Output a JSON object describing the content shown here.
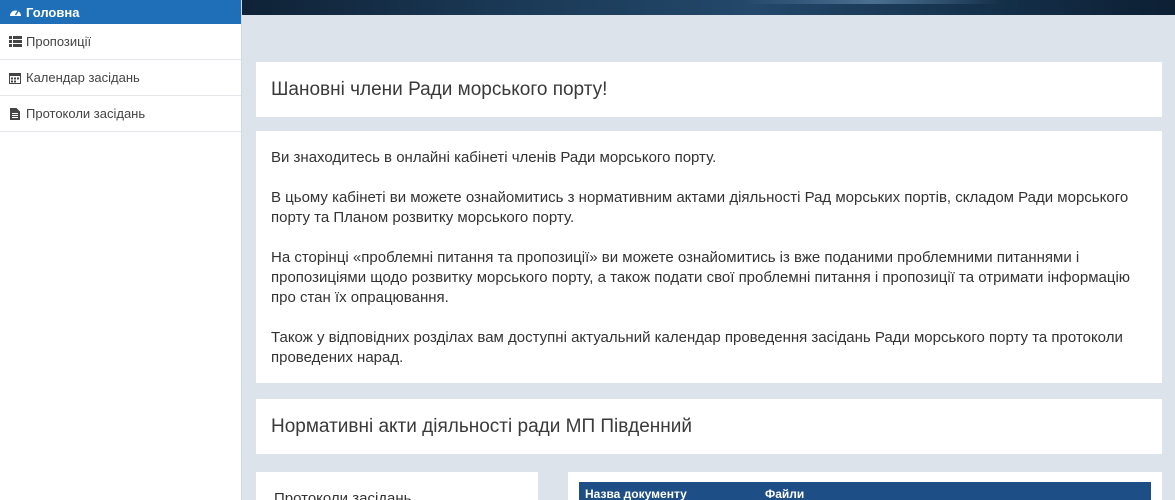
{
  "sidebar": {
    "items": [
      {
        "label": "Головна",
        "icon": "dashboard-icon",
        "active": true
      },
      {
        "label": "Пропозиції",
        "icon": "list-icon",
        "active": false
      },
      {
        "label": "Календар засідань",
        "icon": "calendar-icon",
        "active": false
      },
      {
        "label": "Протоколи засідань",
        "icon": "file-icon",
        "active": false
      }
    ]
  },
  "greeting": {
    "title": "Шановні члени Ради морського порту!"
  },
  "intro": {
    "paragraphs": [
      "Ви знаходитесь в онлайні кабінеті членів Ради морського порту.",
      "В цьому кабінеті ви можете ознайомитись з нормативним актами діяльності Рад морських портів, складом Ради морського порту та Планом розвитку морського порту.",
      "На сторінці «проблемні питання та пропозиції» ви можете ознайомитись із вже поданими проблемними питаннями і пропозиціями щодо розвитку морського порту, а також подати свої проблемні питання і пропозиції та отримати інформацію про стан їх опрацювання.",
      "Також у відповідних розділах вам доступні актуальний календар проведення засідань Ради морського порту та протоколи проведених нарад."
    ]
  },
  "acts": {
    "title": "Нормативні акти діяльності ради МП Південний"
  },
  "protocols": {
    "title": "Протоколи засідань"
  },
  "documents": {
    "columns": [
      "Назва документу",
      "Файли"
    ]
  },
  "colors": {
    "accent": "#1e6fb8",
    "table_header": "#1d4f86",
    "page_background": "#dde3ea"
  }
}
